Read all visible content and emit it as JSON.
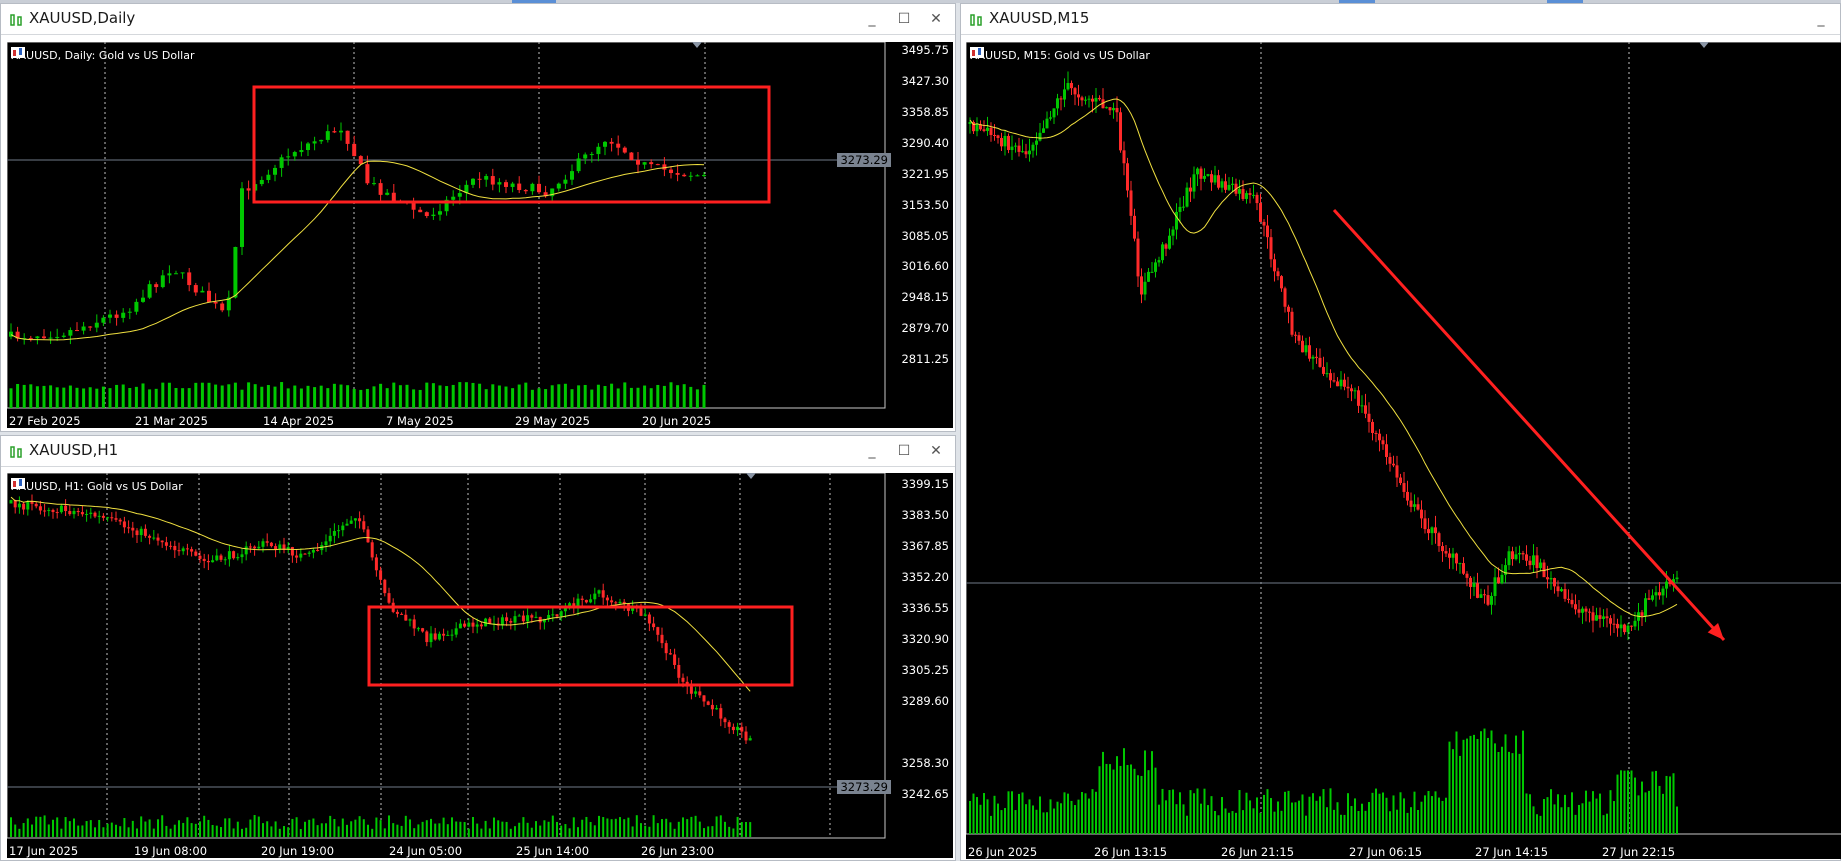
{
  "windows": {
    "daily": {
      "title": "XAUUSD,Daily",
      "chart_header": "XAUUSD, Daily:  Gold vs US Dollar",
      "current_price": "3273.29",
      "y_labels": [
        "3495.75",
        "3427.30",
        "3358.85",
        "3290.40",
        "3221.95",
        "3153.50",
        "3085.05",
        "3016.60",
        "2948.15",
        "2879.70",
        "2811.25"
      ],
      "x_labels": [
        "27 Feb 2025",
        "21 Mar 2025",
        "14 Apr 2025",
        "7 May 2025",
        "29 May 2025",
        "20 Jun 2025"
      ]
    },
    "h1": {
      "title": "XAUUSD,H1",
      "chart_header": "XAUUSD, H1:  Gold vs US Dollar",
      "current_price": "3273.29",
      "y_labels": [
        "3399.15",
        "3383.50",
        "3367.85",
        "3352.20",
        "3336.55",
        "3320.90",
        "3305.25",
        "3289.60",
        "3258.30",
        "3242.65"
      ],
      "x_labels": [
        "17 Jun 2025",
        "19 Jun 08:00",
        "20 Jun 19:00",
        "24 Jun 05:00",
        "25 Jun 14:00",
        "26 Jun 23:00"
      ]
    },
    "m15": {
      "title": "XAUUSD,M15",
      "chart_header": "XAUUSD, M15:  Gold vs US Dollar",
      "x_labels": [
        "26 Jun 2025",
        "26 Jun 13:15",
        "26 Jun 21:15",
        "27 Jun 06:15",
        "27 Jun 14:15",
        "27 Jun 22:15"
      ]
    }
  },
  "window_controls": {
    "minimize": "_",
    "maximize": "☐",
    "close": "✕"
  },
  "colors": {
    "bull_candle": "#00c800",
    "bear_candle": "#ff2a2a",
    "moving_average": "#f0e040",
    "annotation": "#ff2020",
    "chart_background": "#000000"
  }
}
